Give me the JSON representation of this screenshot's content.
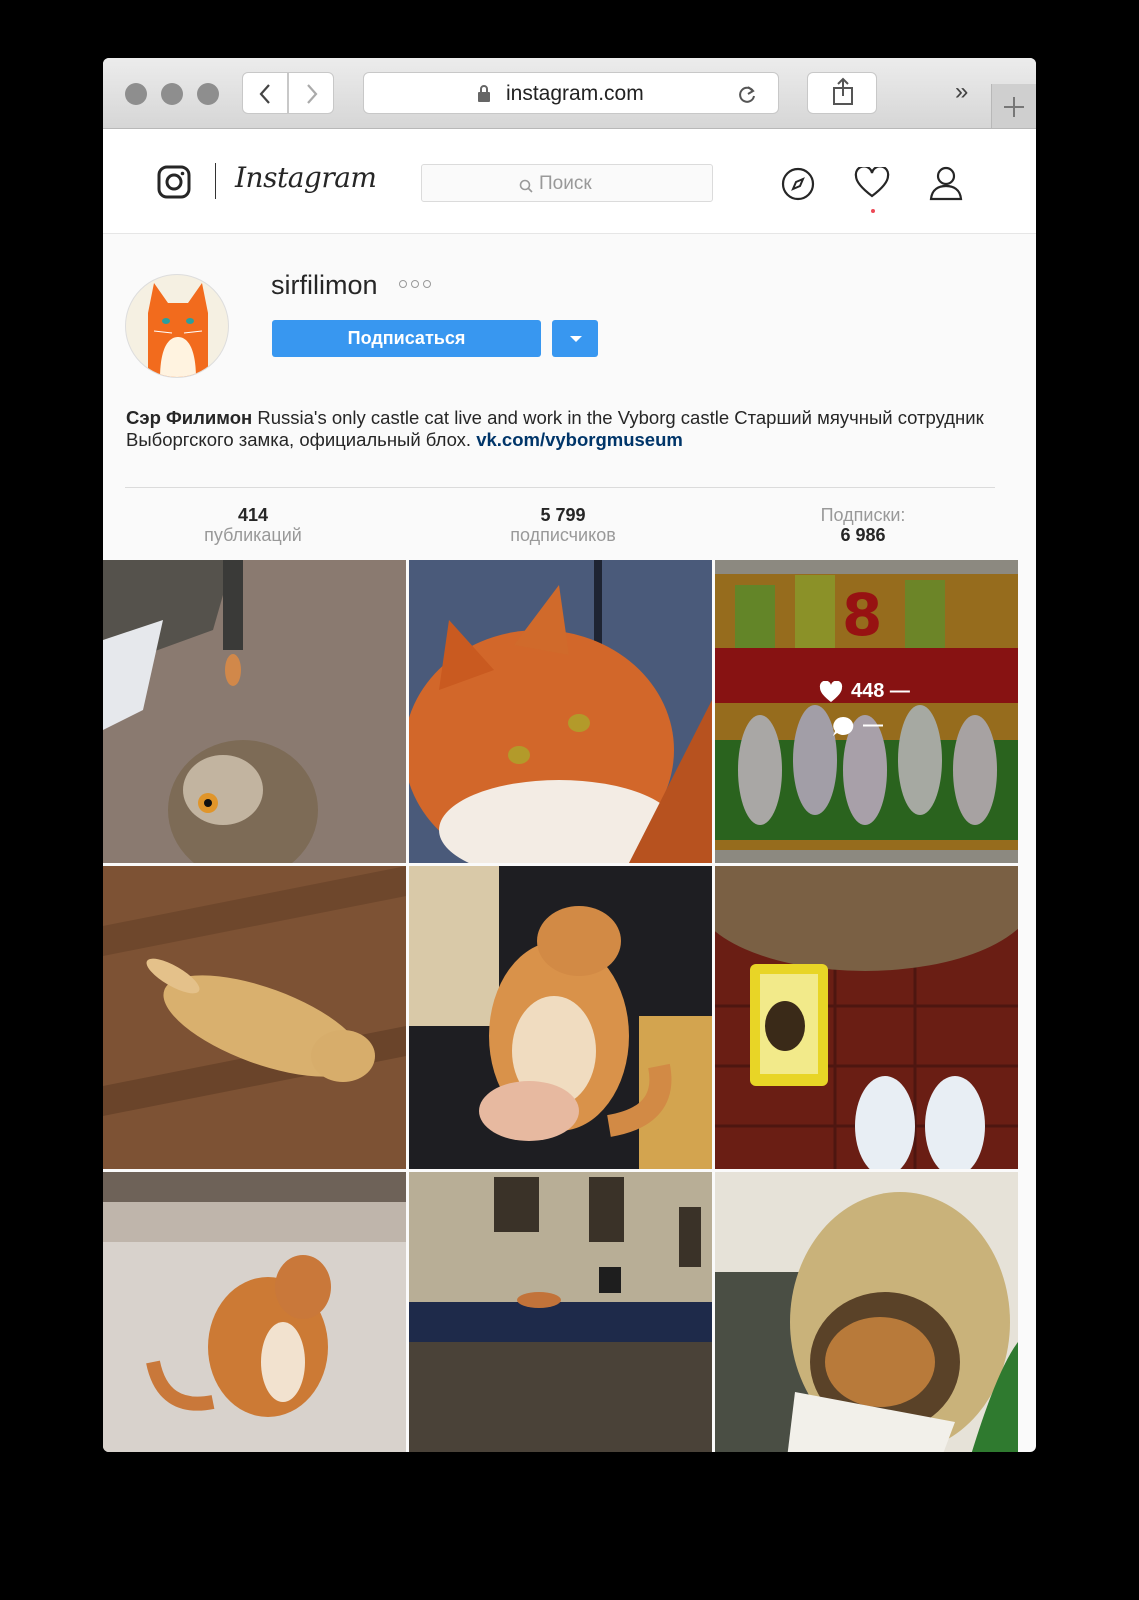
{
  "browser": {
    "url": "instagram.com"
  },
  "header": {
    "wordmark": "Instagram",
    "search_placeholder": "Поиск",
    "colors": {
      "notification_dot": "#ed4956"
    }
  },
  "profile": {
    "username": "sirfilimon",
    "follow_label": "Подписаться",
    "bio_name": "Сэр Филимон",
    "bio_text": " Russia's only castle cat live and work in the Vyborg castle Старший мяучный сотрудник Выборгского замка, официальный блох. ",
    "bio_link": "vk.com/vyborgmuseum",
    "stats": {
      "posts_value": "414",
      "posts_label": "публикаций",
      "followers_value": "5 799",
      "followers_label": "подписчиков",
      "following_label": "Подписки:",
      "following_value": "6 986"
    },
    "accent_color": "#3897f0"
  },
  "posts": [
    {
      "subject": "owl and cat on castle path"
    },
    {
      "subject": "ginger cat close-up"
    },
    {
      "subject": "8 March cats painting",
      "hover": {
        "likes": "448 —",
        "comments": "—"
      }
    },
    {
      "subject": "cat lying on wooden floor"
    },
    {
      "subject": "cat held in arms"
    },
    {
      "subject": "cat over food tray and sneakers"
    },
    {
      "subject": "ginger cat on snow"
    },
    {
      "subject": "cat on roof of old building"
    },
    {
      "subject": "cat in wicker basket"
    }
  ]
}
